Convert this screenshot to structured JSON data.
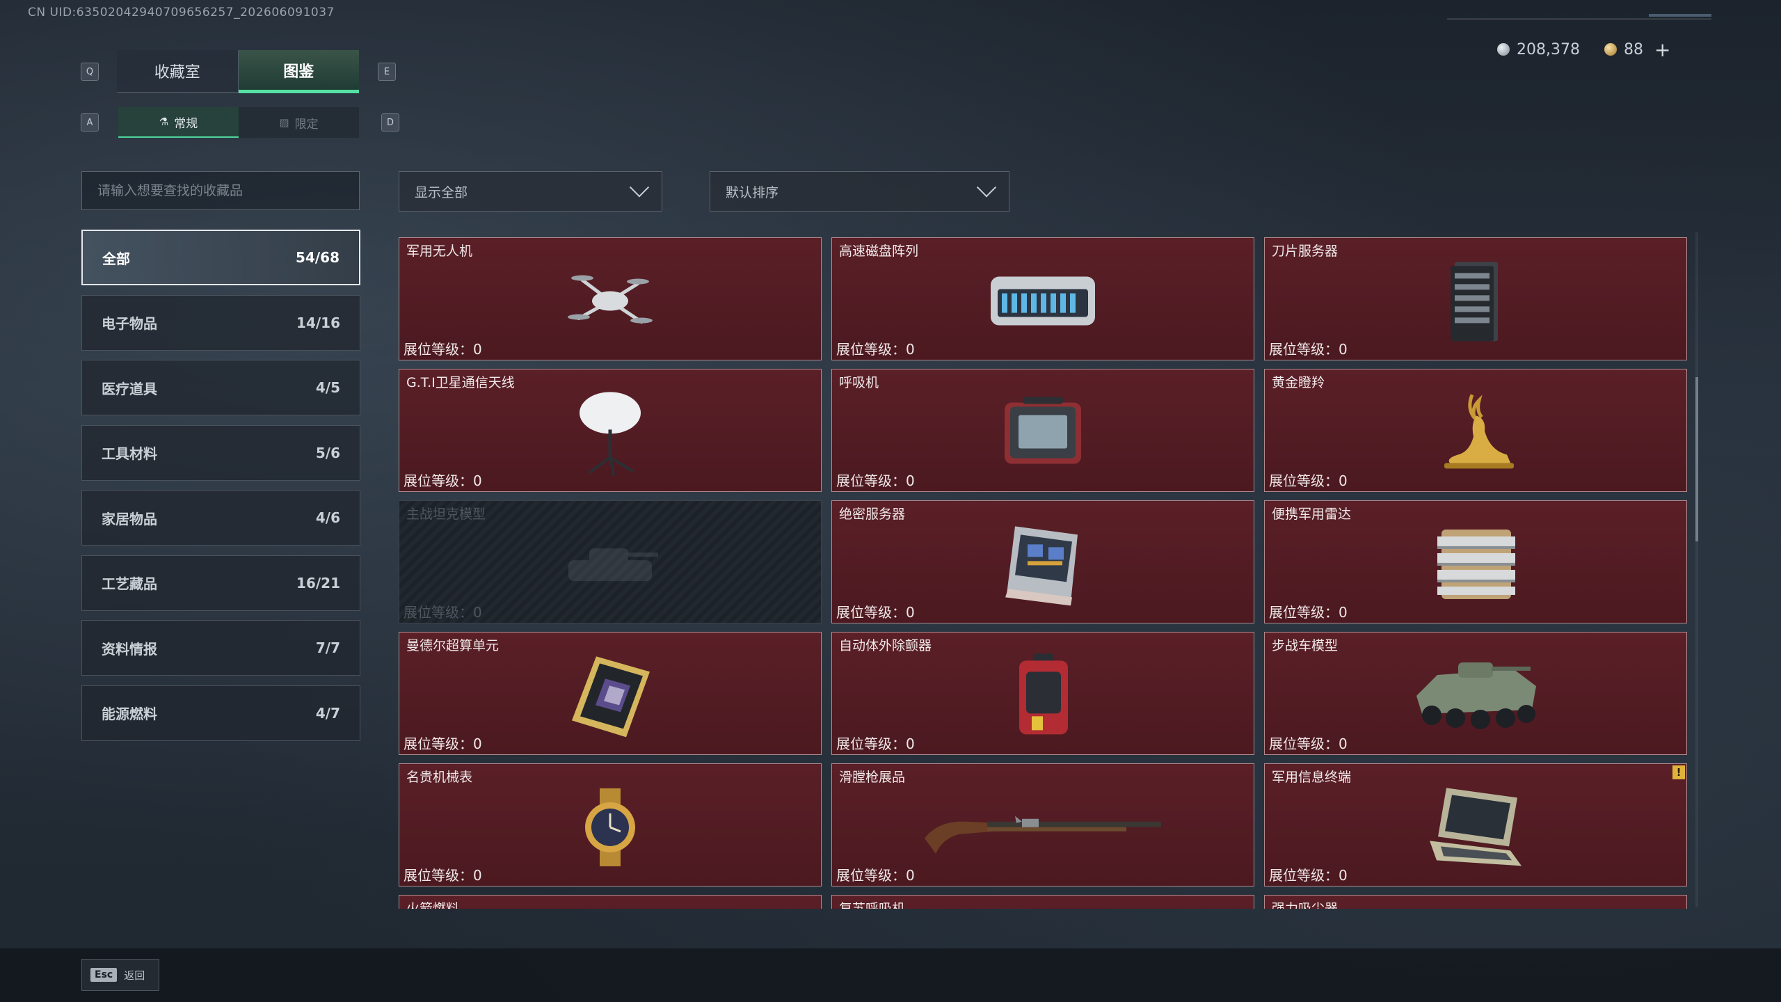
{
  "uid": "CN UID:63502042940709656257_202606091037",
  "currency": {
    "silver": "208,378",
    "gold": "88",
    "add": "+"
  },
  "keys": {
    "prev_tab": "Q",
    "next_tab": "E",
    "prev_sub": "A",
    "next_sub": "D"
  },
  "tabs": [
    {
      "label": "收藏室"
    },
    {
      "label": "图鉴"
    }
  ],
  "subtabs": [
    {
      "label": "常规"
    },
    {
      "label": "限定"
    }
  ],
  "search": {
    "placeholder": "请输入想要查找的收藏品"
  },
  "filters": {
    "show": "显示全部",
    "sort": "默认排序"
  },
  "categories": [
    {
      "label": "全部",
      "count": "54/68"
    },
    {
      "label": "电子物品",
      "count": "14/16"
    },
    {
      "label": "医疗道具",
      "count": "4/5"
    },
    {
      "label": "工具材料",
      "count": "5/6"
    },
    {
      "label": "家居物品",
      "count": "4/6"
    },
    {
      "label": "工艺藏品",
      "count": "16/21"
    },
    {
      "label": "资料情报",
      "count": "7/7"
    },
    {
      "label": "能源燃料",
      "count": "4/7"
    }
  ],
  "level_label": "展位等级：0",
  "items": [
    {
      "name": "军用无人机",
      "icon": "drone-icon"
    },
    {
      "name": "高速磁盘阵列",
      "icon": "disk-array-icon"
    },
    {
      "name": "刀片服务器",
      "icon": "blade-server-icon"
    },
    {
      "name": "G.T.I卫星通信天线",
      "icon": "satellite-dish-icon"
    },
    {
      "name": "呼吸机",
      "icon": "ventilator-icon"
    },
    {
      "name": "黄金瞪羚",
      "icon": "golden-gazelle-icon"
    },
    {
      "name": "主战坦克模型",
      "icon": "tank-model-icon",
      "locked": true
    },
    {
      "name": "绝密服务器",
      "icon": "secret-server-icon"
    },
    {
      "name": "便携军用雷达",
      "icon": "radar-icon"
    },
    {
      "name": "曼德尔超算单元",
      "icon": "supercompute-unit-icon"
    },
    {
      "name": "自动体外除颤器",
      "icon": "defibrillator-icon"
    },
    {
      "name": "步战车模型",
      "icon": "ifv-model-icon"
    },
    {
      "name": "名贵机械表",
      "icon": "watch-icon"
    },
    {
      "name": "滑膛枪展品",
      "icon": "musket-icon"
    },
    {
      "name": "军用信息终端",
      "icon": "terminal-icon",
      "warning": "!"
    },
    {
      "name": "火箭燃料",
      "icon": "fuel-icon"
    },
    {
      "name": "复苏呼吸机",
      "icon": "resuscitator-icon"
    },
    {
      "name": "强力吸尘器",
      "icon": "vacuum-icon"
    }
  ],
  "footer": {
    "esc_key": "Esc",
    "esc_label": "返回"
  }
}
